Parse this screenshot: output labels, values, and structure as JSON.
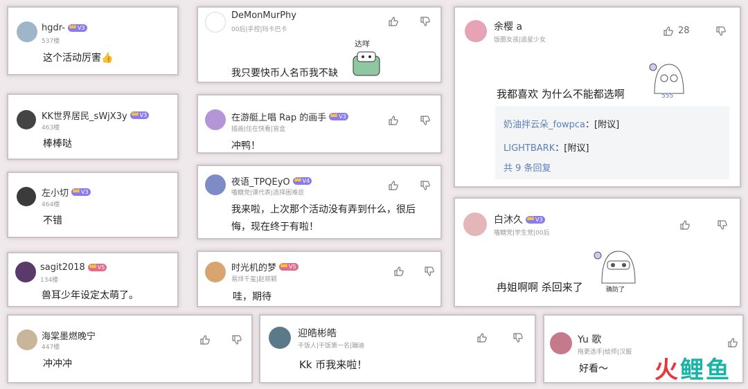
{
  "comments": [
    {
      "name": "hgdr-",
      "level": "",
      "meta": "537楼",
      "text": "这个活动厉害",
      "emoji": "👍"
    },
    {
      "name": "KK世界居民_sWjX3y",
      "level": "V3",
      "meta": "463楼",
      "text": "棒棒哒"
    },
    {
      "name": "左小切",
      "level": "",
      "meta": "464楼",
      "text": "不错"
    },
    {
      "name": "sagit2018",
      "level": "",
      "meta": "134楼",
      "text": "兽耳少年设定太萌了。"
    },
    {
      "name": "DeMonMurPhy",
      "meta": "00后|手控|玛卡巴卡",
      "text": "我只要快币人名币我不缺",
      "sticker_text": "达咩"
    },
    {
      "name": "在游艇上唱 Rap 的画手",
      "level": "V3",
      "meta": "插画|住在快看|盲盒",
      "text": "冲鸭！"
    },
    {
      "name": "夜语_TPQEyO",
      "level": "V4",
      "meta": "嗑糖党|课代表|选择困难症",
      "text": "我来啦，上次那个活动没有弄到什么，很后",
      "text2": "悔，现在终于有啦！"
    },
    {
      "name": "时光机的梦",
      "level": "",
      "meta": "易烊千玺|赵丽颖",
      "text": "哇，期待"
    },
    {
      "name": "余樱 a",
      "meta": "饭圈女孩|追星少女",
      "likes": "28",
      "text": "我都喜欢  为什么不能都选啊",
      "sticker_text": "555",
      "replies": [
        {
          "user": "奶油拌云朵_fowpca",
          "content": "：[附议]"
        },
        {
          "user": "LIGHTBARK",
          "content": "：[附议]"
        }
      ],
      "more": "共 9 条回复"
    },
    {
      "name": "白沐久",
      "level": "V3",
      "meta": "嗑糖党|学生党|00后",
      "text": "冉姐啊啊 杀回来了",
      "sticker_text": "确防了"
    },
    {
      "name": "海棠墨燃晚宁",
      "meta": "447楼",
      "text": "冲冲冲"
    },
    {
      "name": "迎皓彬皓",
      "meta": "干饭人|干饭第一名|蹦迪",
      "text": "Kk 币我来啦！"
    },
    {
      "name": "Yu 歌",
      "meta": "拖更选手|绘师|汉服",
      "text": "好看～"
    }
  ],
  "logo": {
    "part1": "火",
    "part2": "鲤",
    "part3": "鱼"
  },
  "colors": {
    "accent": "#8b7bf0",
    "link": "#5b7fb6",
    "logo_red": "#e8363d",
    "logo_teal": "#19b3a8"
  }
}
